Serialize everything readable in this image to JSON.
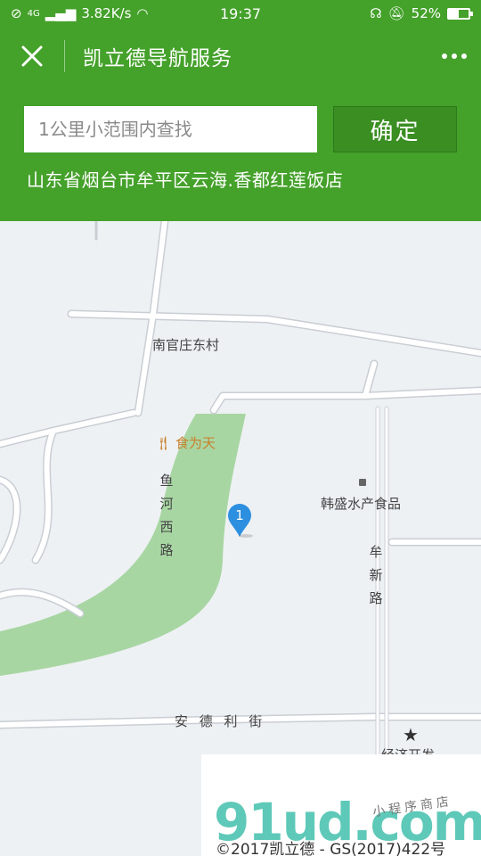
{
  "status_bar": {
    "network_speed": "3.82K/s",
    "network_type": "4G",
    "time": "19:37",
    "battery_percent": "52%",
    "battery_level": 0.52
  },
  "header": {
    "title": "凯立德导航服务",
    "close_icon": "close-icon",
    "more_icon": "more-dots-icon"
  },
  "search": {
    "placeholder": "1公里小范围内查找",
    "value": "",
    "confirm_label": "确定"
  },
  "address": "山东省烟台市牟平区云海.香都红莲饭店",
  "map": {
    "labels": {
      "village": "南官庄东村",
      "restaurant": "食为天",
      "shop": "韩盛水产食品",
      "street_east_west": "安 德 利 街",
      "dev_zone": "经济开发"
    },
    "vertical_labels": {
      "yuhe_road": [
        "鱼",
        "河",
        "西",
        "路"
      ],
      "muxin_road": [
        "牟",
        "新",
        "路"
      ]
    },
    "marker_number": "1",
    "copyright": "©2017凯立德 - GS(2017)422号",
    "watermark": "91ud.com",
    "watermark_sub": "小程序商店",
    "colors": {
      "background": "#eef1f4",
      "green_area": "#a8d6a3",
      "road": "#ffffff",
      "marker": "#2d8fe0"
    }
  },
  "theme": {
    "primary": "#44a12a",
    "button": "#3a8e22"
  }
}
